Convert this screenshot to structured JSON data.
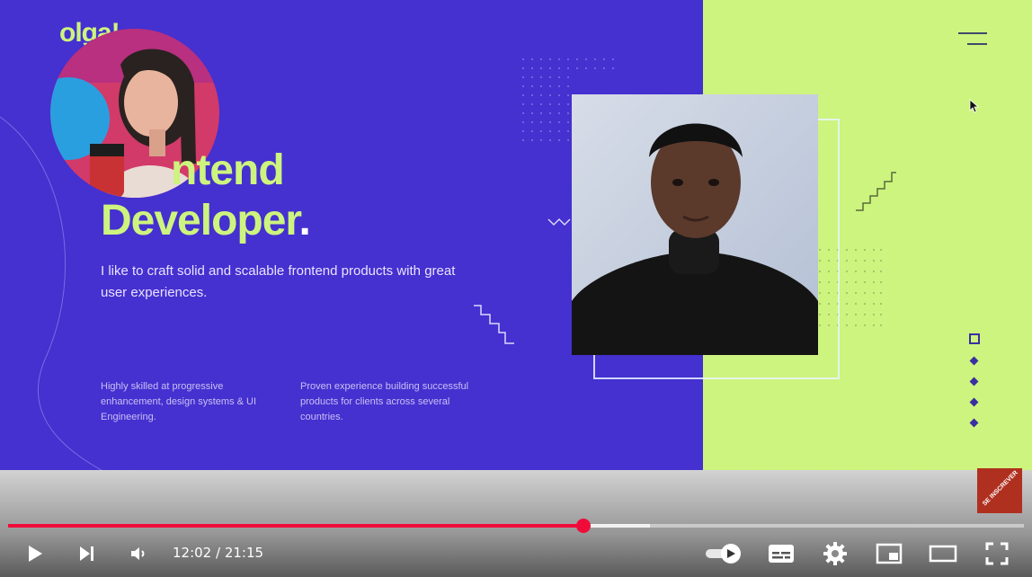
{
  "slide": {
    "logo_text": "olga!",
    "headline_line1": "ntend",
    "headline_line2": "Developer",
    "headline_dot": ".",
    "lead": "I like to craft solid and scalable frontend products with great user experiences.",
    "col1": "Highly skilled at progressive enhancement, design systems & UI Engineering.",
    "col2": "Proven experience building successful products for clients across several countries.",
    "colors": {
      "blue": "#4530d0",
      "green": "#cdf47e"
    }
  },
  "subscribe": {
    "label": "SE INSCREVER"
  },
  "player": {
    "time_display": "12:02 / 21:15",
    "played_fraction": 0.5663,
    "buffered_fraction": 0.632,
    "progress_color": "#f00c3a",
    "icons": [
      "play-icon",
      "next-icon",
      "volume-icon",
      "autoplay-toggle-icon",
      "subtitles-icon",
      "settings-icon",
      "miniplayer-icon",
      "theater-icon",
      "fullscreen-icon"
    ]
  }
}
